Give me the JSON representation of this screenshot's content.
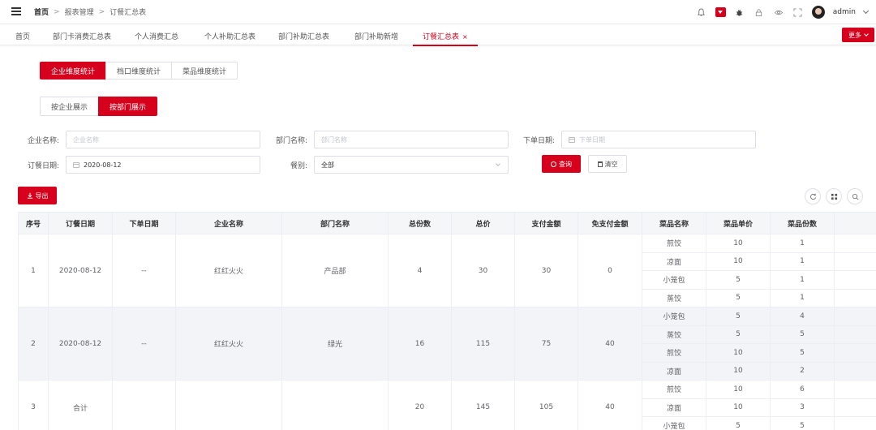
{
  "header": {
    "breadcrumb": [
      "首页",
      "报表管理",
      "订餐汇总表"
    ],
    "username": "admin",
    "colors": {
      "accent": "#d6001c"
    },
    "icons": [
      "bell-icon",
      "message-icon",
      "bug-icon",
      "lock-icon",
      "eye-icon",
      "fullscreen-icon"
    ]
  },
  "tabs": [
    {
      "label": "首页"
    },
    {
      "label": "部门卡消费汇总表"
    },
    {
      "label": "个人消费汇总"
    },
    {
      "label": "个人补助汇总表"
    },
    {
      "label": "部门补助汇总表"
    },
    {
      "label": "部门补助新增"
    },
    {
      "label": "订餐汇总表",
      "close": "×"
    }
  ],
  "more_label": "更多",
  "dimension_tabs": [
    "企业维度统计",
    "档口维度统计",
    "菜品维度统计"
  ],
  "view_tabs": [
    "按企业展示",
    "按部门展示"
  ],
  "filters": {
    "company_label": "企业名称:",
    "company_placeholder": "企业名称",
    "dept_label": "部门名称:",
    "dept_placeholder": "部门名称",
    "order_date_label": "下单日期:",
    "order_date_placeholder": "下单日期",
    "meal_date_label": "订餐日期:",
    "meal_date_value": "2020-08-12",
    "meal_type_label": "餐别:",
    "meal_type_value": "全部",
    "query_label": "查询",
    "clear_label": "清空"
  },
  "export_label": "导出",
  "table": {
    "columns": [
      "序号",
      "订餐日期",
      "下单日期",
      "企业名称",
      "部门名称",
      "总份数",
      "总价",
      "支付金额",
      "免支付金额",
      "菜品名称",
      "菜品单价",
      "菜品份数"
    ],
    "groups": [
      {
        "index": "1",
        "meal_date": "2020-08-12",
        "order_date": "--",
        "company": "红红火火",
        "dept": "产品部",
        "total_qty": "4",
        "total_price": "30",
        "paid": "30",
        "free": "0",
        "dishes": [
          {
            "name": "煎饺",
            "price": "10",
            "qty": "1"
          },
          {
            "name": "凉面",
            "price": "10",
            "qty": "1"
          },
          {
            "name": "小笼包",
            "price": "5",
            "qty": "1"
          },
          {
            "name": "蒸饺",
            "price": "5",
            "qty": "1"
          }
        ]
      },
      {
        "index": "2",
        "meal_date": "2020-08-12",
        "order_date": "--",
        "company": "红红火火",
        "dept": "绿光",
        "total_qty": "16",
        "total_price": "115",
        "paid": "75",
        "free": "40",
        "dishes": [
          {
            "name": "小笼包",
            "price": "5",
            "qty": "4"
          },
          {
            "name": "蒸饺",
            "price": "5",
            "qty": "5"
          },
          {
            "name": "煎饺",
            "price": "10",
            "qty": "5"
          },
          {
            "name": "凉面",
            "price": "10",
            "qty": "2"
          }
        ]
      },
      {
        "index": "3",
        "meal_date": "合计",
        "order_date": "",
        "company": "",
        "dept": "",
        "total_qty": "20",
        "total_price": "145",
        "paid": "105",
        "free": "40",
        "dishes": [
          {
            "name": "煎饺",
            "price": "10",
            "qty": "6"
          },
          {
            "name": "凉面",
            "price": "10",
            "qty": "3"
          },
          {
            "name": "小笼包",
            "price": "5",
            "qty": "5"
          }
        ]
      }
    ]
  }
}
